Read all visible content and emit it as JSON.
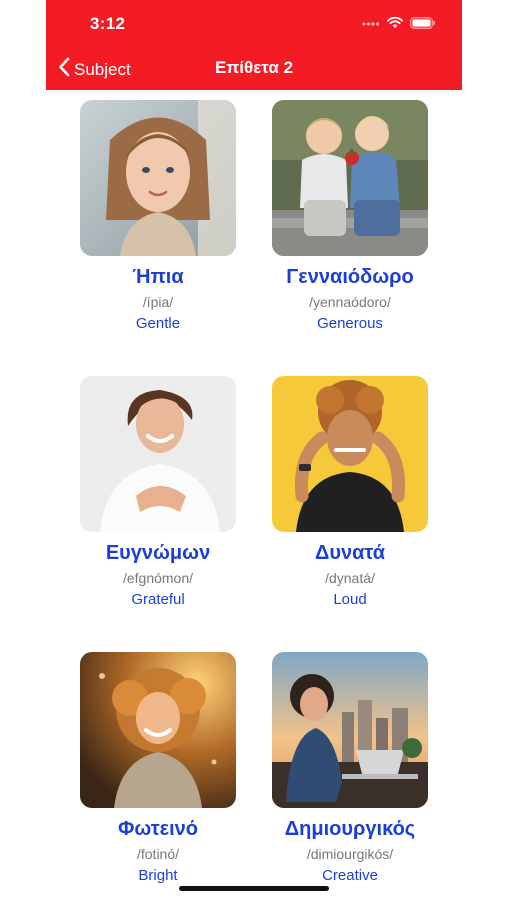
{
  "status_bar": {
    "time": "3:12"
  },
  "nav": {
    "back_label": "Subject",
    "title": "Επίθετα 2"
  },
  "colors": {
    "header_bg": "#f41c24",
    "word_color": "#1b3fd6",
    "phonetic_color": "#777777"
  },
  "cards": [
    {
      "word": "Ήπια",
      "phonetic": "/ípia/",
      "translation": "Gentle",
      "image": "photo of a smiling young girl"
    },
    {
      "word": "Γενναιόδωρο",
      "phonetic": "/yennaódoro/",
      "translation": "Generous",
      "image": "photo of two toddlers sharing an apple"
    },
    {
      "word": "Ευγνώμων",
      "phonetic": "/efgnómon/",
      "translation": "Grateful",
      "image": "photo of a woman with hands on chest"
    },
    {
      "word": "Δυνατά",
      "phonetic": "/dynatá/",
      "translation": "Loud",
      "image": "photo of a man covering his ears on yellow background"
    },
    {
      "word": "Φωτεινό",
      "phonetic": "/fotinó/",
      "translation": "Bright",
      "image": "photo of a girl in golden sunlight"
    },
    {
      "word": "Δημιουργικός",
      "phonetic": "/dimiourgikós/",
      "translation": "Creative",
      "image": "illustration of a woman working at a laptop with a city view"
    }
  ]
}
